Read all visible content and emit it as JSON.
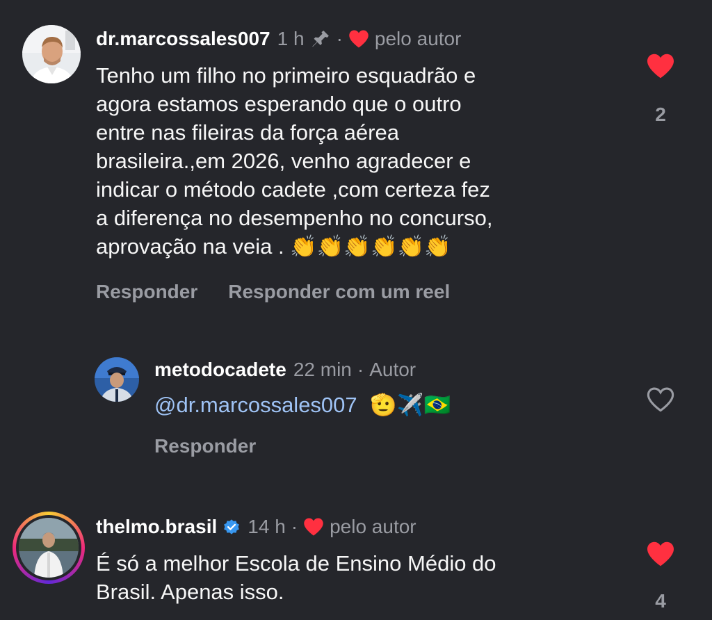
{
  "comments": [
    {
      "username": "dr.marcossales007",
      "time": "1 h",
      "liked_by_author": "pelo autor",
      "lines": [
        "Tenho um filho no primeiro esquadrão e",
        "agora estamos esperando que o outro",
        "entre nas fileiras da força aérea",
        "brasileira.,em 2026, venho agradecer e",
        "indicar o método  cadete ,com certeza fez",
        "a diferença  no desempenho no concurso,",
        "aprovação na veia ."
      ],
      "trailing_emoji": "👏👏👏👏👏👏",
      "reply_label": "Responder",
      "reply_reel_label": "Responder com um reel",
      "like_count": "2",
      "liked": true,
      "pinned": true
    },
    {
      "username": "metodocadete",
      "time": "22 min",
      "author_tag": "Autor",
      "mention": "@dr.marcossales007",
      "emoji": "🫡✈️🇧🇷",
      "reply_label": "Responder",
      "liked": false
    },
    {
      "username": "thelmo.brasil",
      "verified": true,
      "time": "14 h",
      "liked_by_author": "pelo autor",
      "lines": [
        "É só a melhor Escola de Ensino Médio do",
        "Brasil. Apenas isso."
      ],
      "like_count": "4",
      "liked": true,
      "has_story": true
    }
  ],
  "separator": "·",
  "colors": {
    "background": "#25262b",
    "like_red": "#ff3040",
    "muted": "#9a9ca3",
    "mention": "#9fc3f5",
    "verified_blue": "#3897f0"
  },
  "icons": {
    "pin": "pin-icon",
    "heart_filled": "heart-filled-icon",
    "heart_outline": "heart-outline-icon",
    "verified": "verified-badge-icon"
  }
}
